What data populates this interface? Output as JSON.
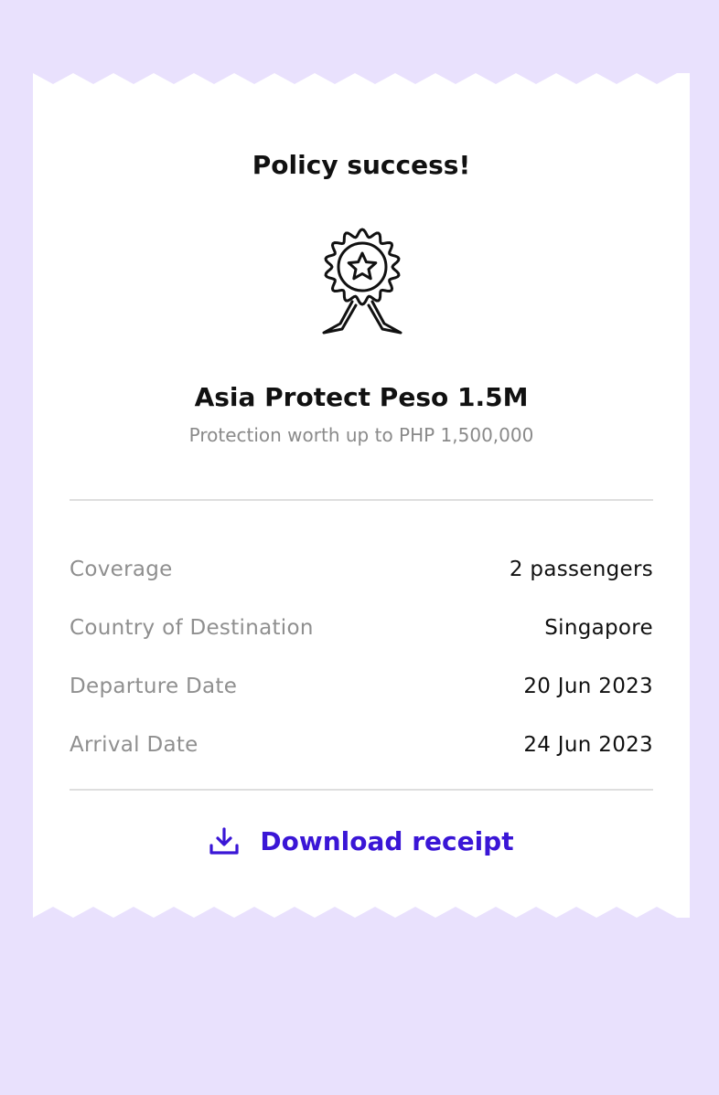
{
  "receipt": {
    "title": "Policy success!",
    "badge_icon": "award-ribbon-star-icon",
    "plan_name": "Asia Protect Peso 1.5M",
    "plan_subtitle": "Protection worth up to PHP 1,500,000",
    "details": [
      {
        "label": "Coverage",
        "value": "2 passengers"
      },
      {
        "label": "Country of Destination",
        "value": "Singapore"
      },
      {
        "label": "Departure Date",
        "value": "20 Jun 2023"
      },
      {
        "label": "Arrival Date",
        "value": "24 Jun 2023"
      }
    ],
    "download": {
      "icon": "download-icon",
      "label": "Download receipt"
    }
  },
  "colors": {
    "background": "#e9e1fd",
    "card": "#ffffff",
    "accent": "#3a16d6",
    "muted_text": "#8f8f8f",
    "text": "#111111"
  }
}
